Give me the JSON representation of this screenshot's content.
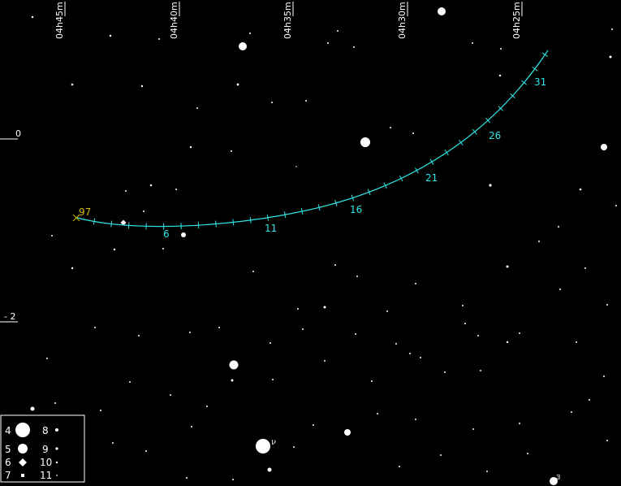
{
  "ra_labels": [
    "04h45m",
    "04h40m",
    "04h35m",
    "04h30m",
    "04h25m"
  ],
  "dec_labels": [
    "0",
    "- 2"
  ],
  "track": {
    "start_label": "97",
    "day_labels": [
      "6",
      "11",
      "16",
      "21",
      "26",
      "31"
    ]
  },
  "star_labels": [
    "ν",
    "ω"
  ],
  "legend": {
    "rows": [
      {
        "left": "4",
        "right": "8"
      },
      {
        "left": "5",
        "right": "9"
      },
      {
        "left": "6",
        "right": "10"
      },
      {
        "left": "7",
        "right": "11"
      }
    ]
  },
  "colors": {
    "background": "#000000",
    "track": "#2ee6e6",
    "year_marker": "#d4b800",
    "stars": "#ffffff"
  }
}
